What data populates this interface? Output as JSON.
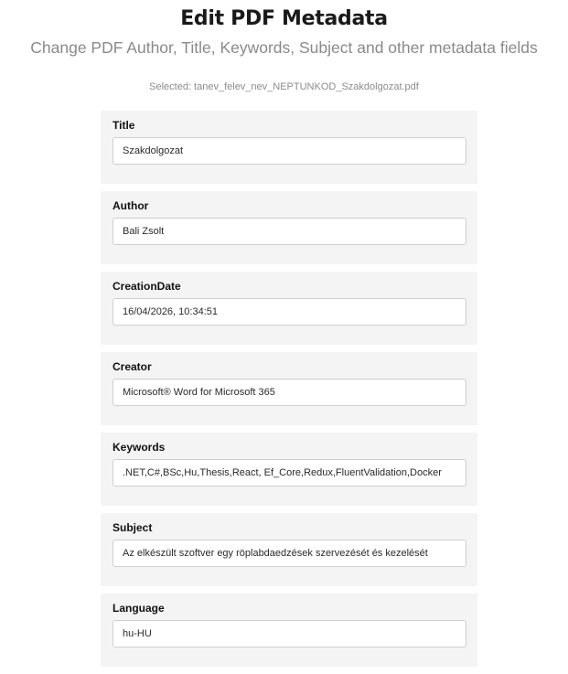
{
  "header": {
    "title": "Edit PDF Metadata",
    "subtitle": "Change PDF Author, Title, Keywords, Subject and other metadata fields",
    "selected_file": "Selected: tanev_felev_nev_NEPTUNKOD_Szakdolgozat.pdf"
  },
  "fields": [
    {
      "label": "Title",
      "value": "Szakdolgozat"
    },
    {
      "label": "Author",
      "value": "Bali Zsolt"
    },
    {
      "label": "CreationDate",
      "value": "16/04/2026, 10:34:51"
    },
    {
      "label": "Creator",
      "value": "Microsoft® Word for Microsoft 365"
    },
    {
      "label": "Keywords",
      "value": ".NET,C#,BSc,Hu,Thesis,React, Ef_Core,Redux,FluentValidation,Docker"
    },
    {
      "label": "Subject",
      "value": "Az elkészült szoftver egy röplabdaedzések szervezését és kezelését"
    },
    {
      "label": "Language",
      "value": "hu-HU"
    }
  ]
}
